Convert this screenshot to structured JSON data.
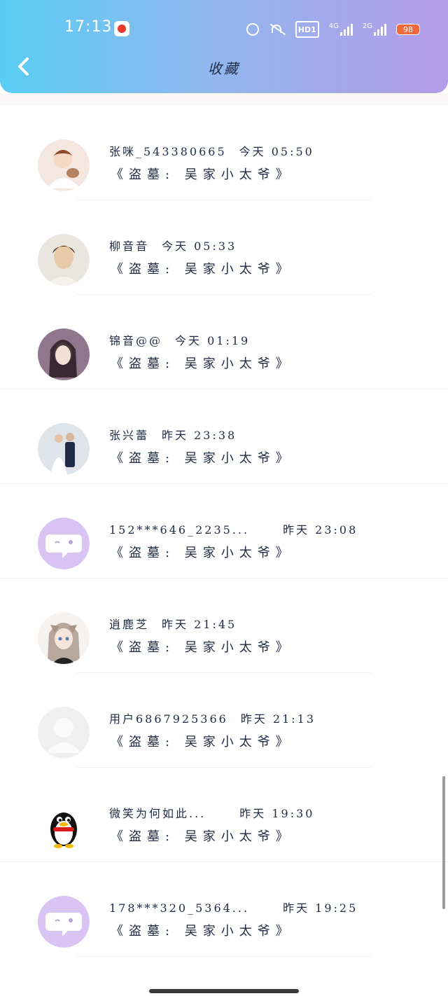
{
  "status_bar": {
    "time": "17:13",
    "hd_label": "HD1",
    "net1_label": "4G",
    "net2_label": "2G",
    "battery": "98"
  },
  "header": {
    "title": "收藏",
    "back_icon": "chevron-left-icon"
  },
  "items": [
    {
      "name": "张咪_543380665",
      "time": "今天 05:50",
      "collection": "《盗墓: 吴家小太爷》",
      "avatar": "anime-boy",
      "avatar_bg": "#f3e7df"
    },
    {
      "name": "柳音音",
      "time": "今天 05:33",
      "collection": "《盗墓: 吴家小太爷》",
      "avatar": "photo-woman",
      "avatar_bg": "#e9e6df"
    },
    {
      "name": "锦音@@",
      "time": "今天 01:19",
      "collection": "《盗墓: 吴家小太爷》",
      "avatar": "photo-costume",
      "avatar_bg": "#5b3a4a"
    },
    {
      "name": "张兴蕾",
      "time": "昨天 23:38",
      "collection": "《盗墓: 吴家小太爷》",
      "avatar": "photo-wedding",
      "avatar_bg": "#dfe3ea"
    },
    {
      "name": "152***646_2235...",
      "time": "昨天 23:08",
      "collection": "《盗墓: 吴家小太爷》",
      "avatar": "chat-bubble",
      "avatar_bg": "#d9c3f2"
    },
    {
      "name": "逍鹿芝",
      "time": "昨天 21:45",
      "collection": "《盗墓: 吴家小太爷》",
      "avatar": "anime-girl",
      "avatar_bg": "#d8d0cc"
    },
    {
      "name": "用户6867925366",
      "time": "昨天 21:13",
      "collection": "《盗墓: 吴家小太爷》",
      "avatar": "default-user",
      "avatar_bg": "#efefef"
    },
    {
      "name": "微笑为何如此...",
      "time": "昨天 19:30",
      "collection": "《盗墓: 吴家小太爷》",
      "avatar": "penguin",
      "avatar_bg": "#ffffff"
    },
    {
      "name": "178***320_5364...",
      "time": "昨天 19:25",
      "collection": "《盗墓: 吴家小太爷》",
      "avatar": "chat-bubble",
      "avatar_bg": "#d9c3f2"
    }
  ]
}
